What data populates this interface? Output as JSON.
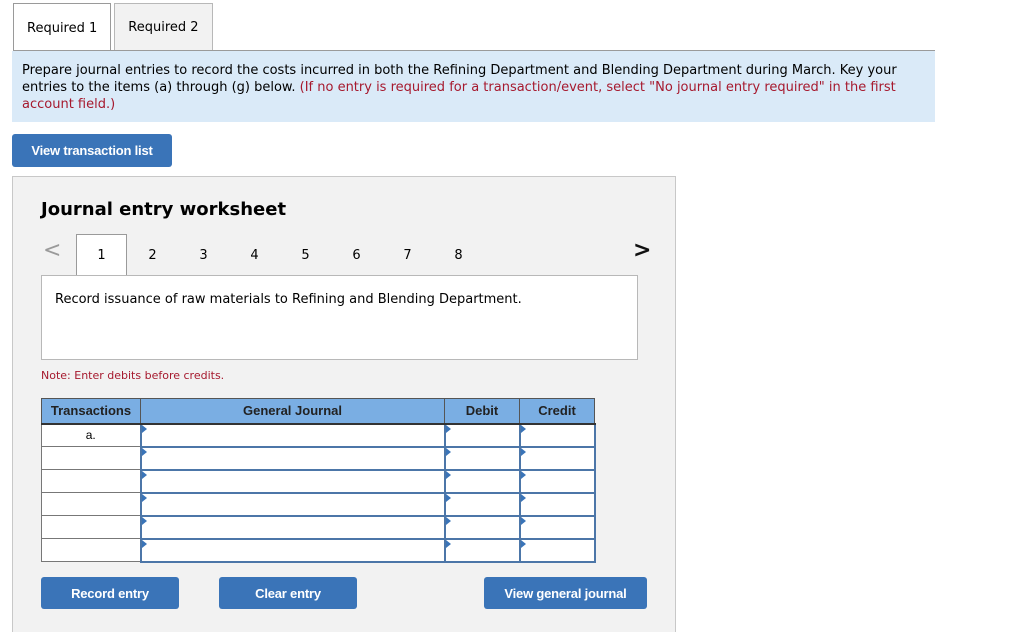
{
  "tabs": [
    {
      "label": "Required 1",
      "active": true
    },
    {
      "label": "Required 2",
      "active": false
    }
  ],
  "instructions": {
    "text": "Prepare journal entries to record the costs incurred in both the Refining Department and Blending Department during March. Key your entries to the items (a) through (g) below. ",
    "note_red": "(If no entry is required for a transaction/event, select \"No journal entry required\" in the first account field.)"
  },
  "buttons": {
    "view_transaction_list": "View transaction list",
    "record_entry": "Record entry",
    "clear_entry": "Clear entry",
    "view_general_journal": "View general journal"
  },
  "worksheet": {
    "title": "Journal entry worksheet",
    "prev_icon": "<",
    "next_icon": ">",
    "pages": [
      "1",
      "2",
      "3",
      "4",
      "5",
      "6",
      "7",
      "8"
    ],
    "active_page": "1",
    "description": "Record issuance of raw materials to Refining and Blending Department.",
    "note": "Note: Enter debits before credits."
  },
  "journal_table": {
    "headers": [
      "Transactions",
      "General Journal",
      "Debit",
      "Credit"
    ],
    "rows": [
      {
        "transaction": "a.",
        "account": "",
        "debit": "",
        "credit": ""
      },
      {
        "transaction": "",
        "account": "",
        "debit": "",
        "credit": ""
      },
      {
        "transaction": "",
        "account": "",
        "debit": "",
        "credit": ""
      },
      {
        "transaction": "",
        "account": "",
        "debit": "",
        "credit": ""
      },
      {
        "transaction": "",
        "account": "",
        "debit": "",
        "credit": ""
      },
      {
        "transaction": "",
        "account": "",
        "debit": "",
        "credit": ""
      }
    ]
  },
  "colors": {
    "accent_button": "#3a74b8",
    "instruction_bg": "#daeaf8",
    "table_header_bg": "#7aaee3",
    "note_red": "#a6192e"
  }
}
